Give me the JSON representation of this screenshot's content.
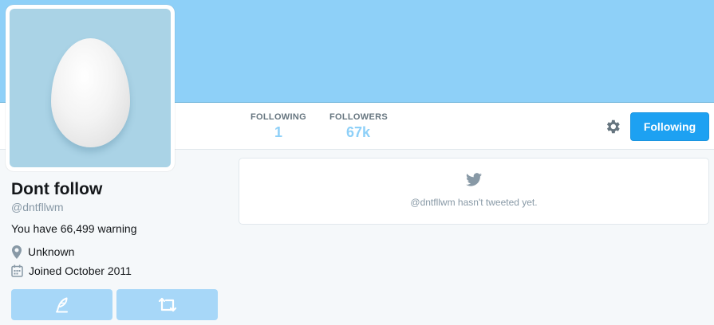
{
  "colors": {
    "banner": "#8ed0f8",
    "accent": "#1da1f2",
    "stat_value": "#8ed0f8",
    "muted_text": "#8899a6",
    "action_button": "#a7d7f8",
    "avatar_bg": "#aad3e6"
  },
  "nav": {
    "stats": [
      {
        "label": "FOLLOWING",
        "value": "1"
      },
      {
        "label": "FOLLOWERS",
        "value": "67k"
      }
    ],
    "settings_icon": "gear-icon",
    "follow_button_label": "Following"
  },
  "profile": {
    "avatar_icon": "default-egg-avatar",
    "name": "Dont follow",
    "handle": "@dntfllwm",
    "bio": "You have 66,499 warning",
    "location": "Unknown",
    "location_icon": "map-pin-icon",
    "joined": "Joined October 2011",
    "joined_icon": "calendar-icon",
    "actions": [
      {
        "icon": "compose-tweet-icon"
      },
      {
        "icon": "retweet-icon"
      }
    ]
  },
  "timeline": {
    "icon": "twitter-bird-icon",
    "empty_message": "@dntfllwm hasn't tweeted yet."
  }
}
